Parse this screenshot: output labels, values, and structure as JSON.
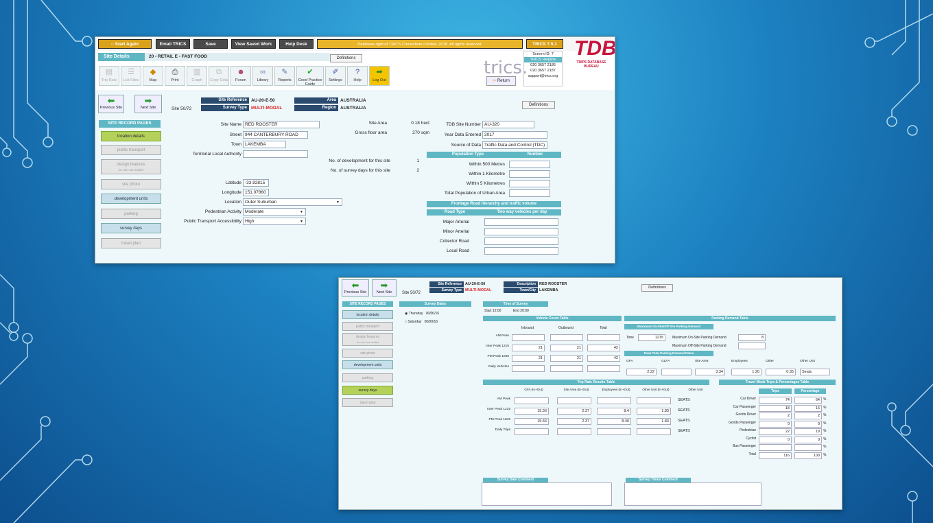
{
  "top": {
    "start": "Start Again",
    "email": "Email TRICS",
    "save": "Save",
    "view": "View Saved Work",
    "help": "Help Desk",
    "notice": "Database right of TRICS Consortium Limited, 2018. All rights reserved.",
    "version": "TRICS 7.5.1"
  },
  "title": {
    "section": "Site Details",
    "site": "20 - RETAIL E - FAST FOOD",
    "definitions": "Definitions"
  },
  "toolbar": {
    "trip": "Trip Rate",
    "list": "List Sites",
    "map": "Map",
    "print": "Print",
    "graph": "Graph",
    "copy": "Copy Data",
    "forum": "Forum",
    "library": "Library",
    "reports": "Reports",
    "gpg": "Good Practice Guide",
    "settings": "Settings",
    "helpb": "Help",
    "logout": "Log Out",
    "return": "Return"
  },
  "logo": {
    "trics": "trics.",
    "screen": "Screen ID: 7",
    "helpline": "TRICS Helpline",
    "phone1": "020 3657 2186",
    "phone2": "020 3657 2187",
    "email": "support@trics.org",
    "tdb": "TDB",
    "tdb_sub": "TRIPS DATABASE BUREAU"
  },
  "nav": {
    "prev": "Previous Site",
    "next": "Next Site",
    "count": "Site 50/72"
  },
  "site": {
    "ref_label": "Site Reference",
    "ref": "AU-20-E-50",
    "type_label": "Survey Type",
    "type": "MULTI-MODAL",
    "area_label": "Area",
    "area": "AUSTRALIA",
    "region_label": "Region",
    "region": "AUSTRALIA"
  },
  "sidebar": {
    "header": "SITE RECORD PAGES",
    "items": [
      "location details",
      "public transport",
      "design features",
      "site photo",
      "development units",
      "parking",
      "survey days",
      "travel plan"
    ],
    "design_sub": "for non-car modes"
  },
  "loc": {
    "site_name_l": "Site Name",
    "site_name": "RED ROOSTER",
    "street_l": "Street",
    "street": "944 CANTERBURY ROAD",
    "town_l": "Town",
    "town": "LAKEMBA",
    "tla_l": "Territorial Local Authority",
    "lat_l": "Latitude",
    "lat": "-33.92815",
    "lon_l": "Longitude",
    "lon": "151.07860",
    "location_l": "Location",
    "location": "Outer Suburban",
    "ped_l": "Pedestrian Activity",
    "ped": "Moderate",
    "pta_l": "Public Transport Accessibility",
    "pta": "High"
  },
  "areas": {
    "site_area_l": "Site Area",
    "site_area": "0.18 hect",
    "gfa_l": "Gross floor area",
    "gfa": "270 sqm",
    "dev_l": "No. of development for this site",
    "dev": "1",
    "days_l": "No. of survey days for this site",
    "days": "2"
  },
  "tdb": {
    "num_l": "TDB Site Number",
    "num": "AU-320",
    "year_l": "Year Data Entered",
    "year": "2017",
    "source_l": "Source of Data",
    "source": "Traffic Data and Control (TDC)"
  },
  "pop": {
    "h1": "Population Type",
    "h2": "Number",
    "rows": [
      "Within 500 Metres",
      "Within 1 Kilometre",
      "Within 5 Kilometres",
      "Total Population of Urban Area"
    ]
  },
  "front": {
    "title": "Frontage Road hierarchy and traffic volume",
    "h1": "Road Type",
    "h2": "Two way vehicles per day",
    "rows": [
      "Major Arterial",
      "Minor Arterial",
      "Collector Road",
      "Local Road"
    ]
  },
  "w2": {
    "desc_label": "Description",
    "desc": "RED ROOSTER",
    "town_label": "Town/City",
    "town": "LAKEMBA",
    "survey_dates": "Survey Dates",
    "d1_day": "Thursday",
    "d1": "00/00/16",
    "d2_day": "Saturday",
    "d2": "00/00/16",
    "time_title": "Time of Survey",
    "start": "Start  12:00",
    "end": "End  20:00"
  },
  "vct": {
    "title": "Vehicle Count Table",
    "cols": [
      "Inbound",
      "Outbound",
      "Total"
    ],
    "rows": [
      {
        "l": "AM Peak",
        "v": [
          "",
          "",
          ""
        ]
      },
      {
        "l": "Inter Peak 1215",
        "v": [
          "21",
          "21",
          "42"
        ]
      },
      {
        "l": "PM Peak 1845",
        "v": [
          "21",
          "21",
          "42"
        ]
      },
      {
        "l": "Daily Vehicles",
        "v": [
          "",
          "",
          ""
        ]
      }
    ]
  },
  "pdt": {
    "title": "Parking Demand Table",
    "sub1": "Maximum On-Site/Off Site Parking Demand",
    "time_l": "Time",
    "time": "1215",
    "onsite_l": "Maximum On-Site Parking Demand",
    "onsite": "8",
    "offsite_l": "Maximum Off-Site Parking Demand",
    "sub2": "Peak Total Parking Demand Rates",
    "cols": [
      "GFA",
      "GLFA",
      "Site Area",
      "Employees",
      "Other",
      "Other Unit"
    ],
    "vals": [
      "2.22",
      "",
      "3.34",
      "1.20",
      "0.35",
      "Seats"
    ]
  },
  "trt": {
    "title": "Trip Rate Results Table",
    "cols": [
      "GFA (In+Out)",
      "Site Area (In+Out)",
      "Employees (In+Out)",
      "Other Unit (In+Out)",
      "Other Unit"
    ],
    "rows": [
      {
        "l": "AM Peak",
        "v": [
          "",
          "",
          "",
          "",
          "SEATS"
        ]
      },
      {
        "l": "Inter Peak 1215",
        "v": [
          "15.56",
          "2.37",
          "8.4",
          "1.83",
          "SEATS"
        ]
      },
      {
        "l": "PM Peak 1845",
        "v": [
          "15.56",
          "2.37",
          "8.40",
          "1.83",
          "SEATS"
        ]
      },
      {
        "l": "Daily Trips",
        "v": [
          "",
          "",
          "",
          "",
          "SEATS"
        ]
      }
    ]
  },
  "tm": {
    "title": "Travel Mode Trips & Percentages Table",
    "cols": [
      "Trips",
      "Percentage"
    ],
    "rows": [
      {
        "l": "Car Driver",
        "t": "74",
        "p": "64"
      },
      {
        "l": "Car Passenger",
        "t": "18",
        "p": "16"
      },
      {
        "l": "Goods Driver",
        "t": "2",
        "p": "2"
      },
      {
        "l": "Goods Passenger",
        "t": "0",
        "p": "0"
      },
      {
        "l": "Pedestrian",
        "t": "22",
        "p": "19"
      },
      {
        "l": "Cyclist",
        "t": "0",
        "p": "0"
      },
      {
        "l": "Bus Passenger",
        "t": "",
        "p": ""
      },
      {
        "l": "Total",
        "t": "116",
        "p": "100"
      }
    ]
  },
  "comments": {
    "day": "Survey Date Comment",
    "time": "Survey Times Comment"
  }
}
